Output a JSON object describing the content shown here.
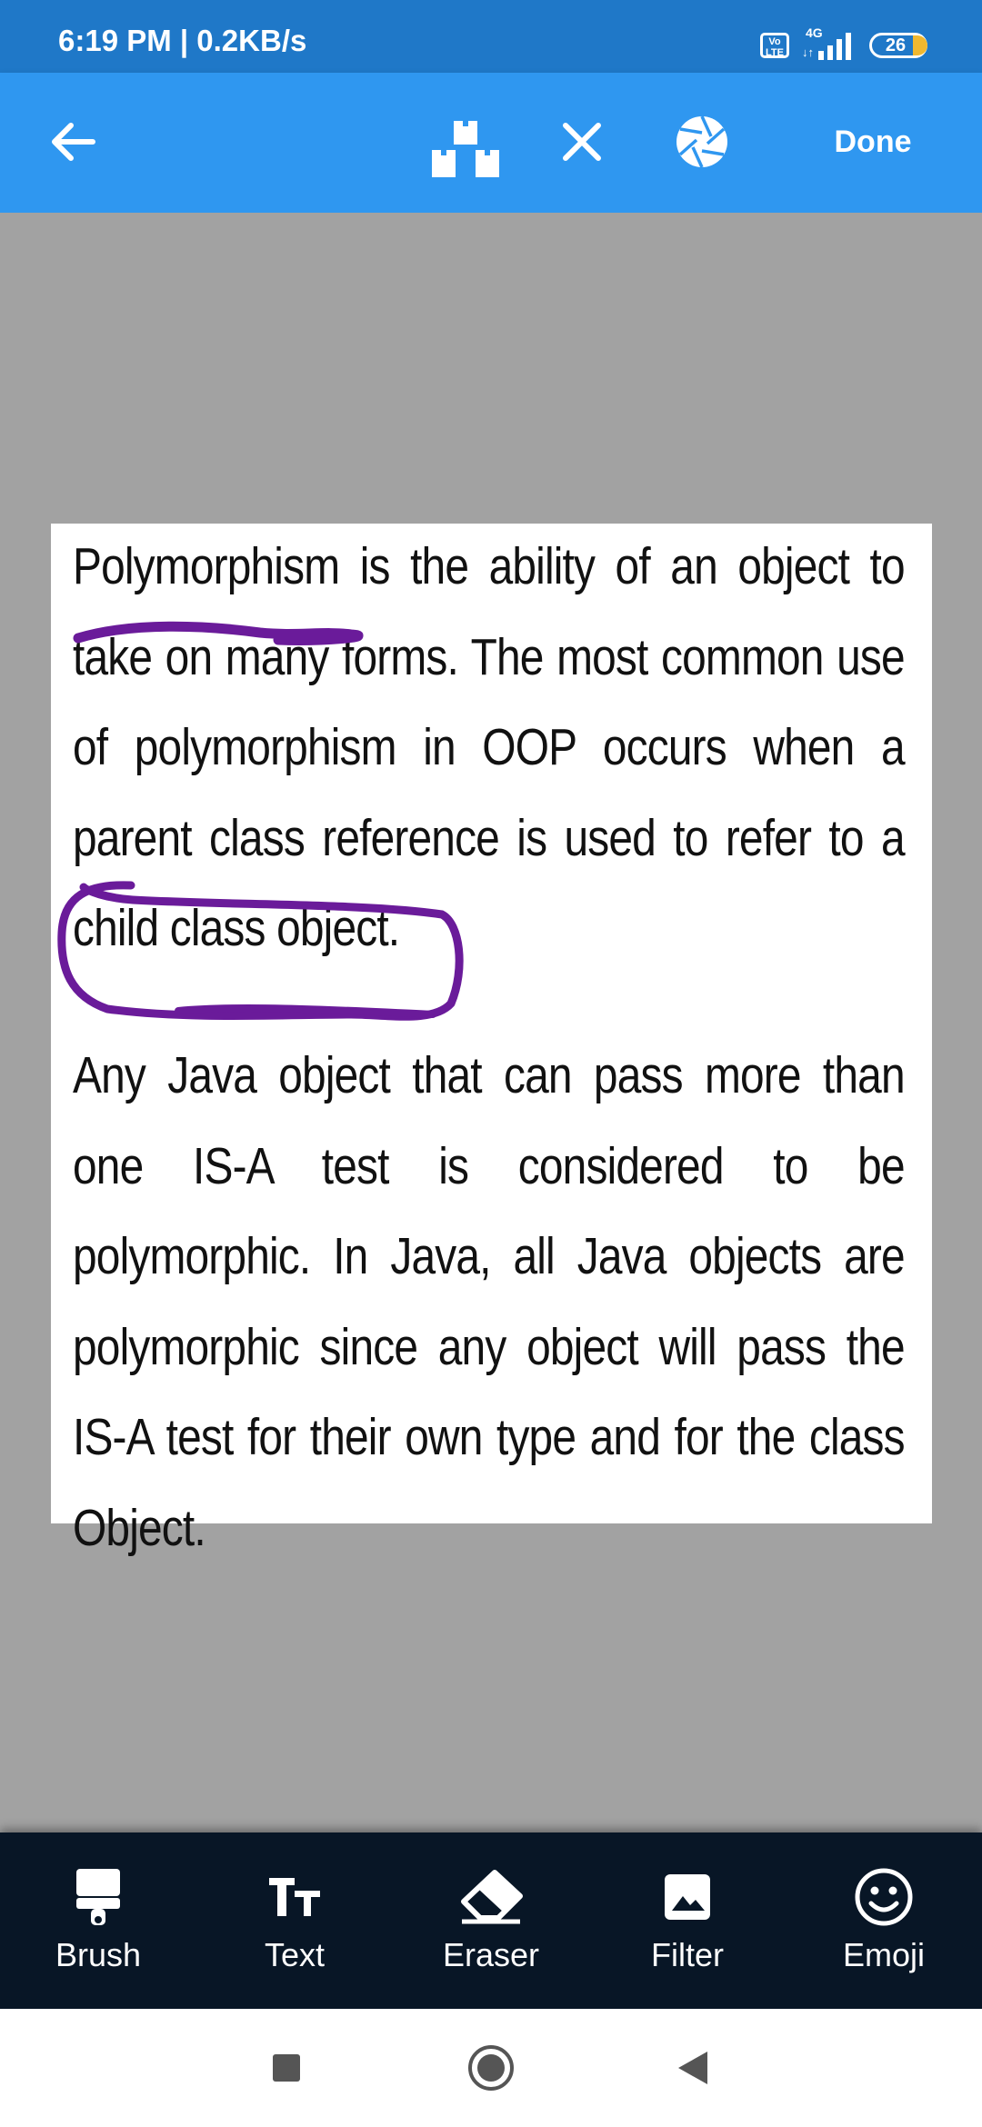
{
  "status_bar": {
    "time": "6:19 PM | 0.2KB/s",
    "volte": "Vo\nLTE",
    "network": "4G",
    "battery": "26",
    "icons": [
      "volte-icon",
      "signal-icon",
      "battery-icon"
    ]
  },
  "toolbar": {
    "back_icon": "arrow-left-icon",
    "crop_icon": "crop-blocks-icon",
    "close_icon": "close-icon",
    "shutter_icon": "aperture-icon",
    "done_label": "Done"
  },
  "document": {
    "paragraph_1": "Polymorphism is the ability of an object to take on many forms. The most common use of polymorphism in OOP occurs when a parent class reference is used to refer to a child class object.",
    "paragraph_2": "Any Java object that can pass more than one IS-A test is considered to be polymorphic. In Java, all Java objects are polymorphic since any object will pass the IS-A test for their own type and for the class Object.",
    "annotation_color": "#6a1b9a"
  },
  "tools": [
    {
      "label": "Brush",
      "icon": "brush-icon"
    },
    {
      "label": "Text",
      "icon": "text-icon"
    },
    {
      "label": "Eraser",
      "icon": "eraser-icon"
    },
    {
      "label": "Filter",
      "icon": "image-filter-icon"
    },
    {
      "label": "Emoji",
      "icon": "emoji-icon"
    }
  ],
  "nav_bar": {
    "icons": [
      "recents-square-icon",
      "home-circle-icon",
      "back-triangle-icon"
    ]
  },
  "colors": {
    "status_bar": "#1f78c8",
    "toolbar": "#2f97f0",
    "canvas_bg": "#a2a2a2",
    "tools_bg": "#081626"
  }
}
